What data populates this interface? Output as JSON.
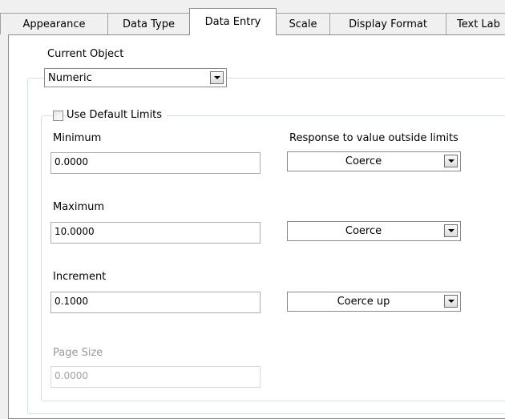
{
  "tabs": [
    {
      "label": "Appearance",
      "active": false
    },
    {
      "label": "Data Type",
      "active": false
    },
    {
      "label": "Data Entry",
      "active": true
    },
    {
      "label": "Scale",
      "active": false
    },
    {
      "label": "Display Format",
      "active": false
    },
    {
      "label": "Text Lab",
      "active": false
    }
  ],
  "current_object": {
    "label": "Current Object",
    "value": "Numeric"
  },
  "default_limits": {
    "label": "Use Default Limits",
    "checked": false
  },
  "response_header": "Response to value outside limits",
  "fields": {
    "minimum": {
      "label": "Minimum",
      "value": "0.0000",
      "response": "Coerce"
    },
    "maximum": {
      "label": "Maximum",
      "value": "10.0000",
      "response": "Coerce"
    },
    "increment": {
      "label": "Increment",
      "value": "0.1000",
      "response": "Coerce up"
    },
    "page_size": {
      "label": "Page Size",
      "value": "0.0000",
      "enabled": false
    }
  }
}
